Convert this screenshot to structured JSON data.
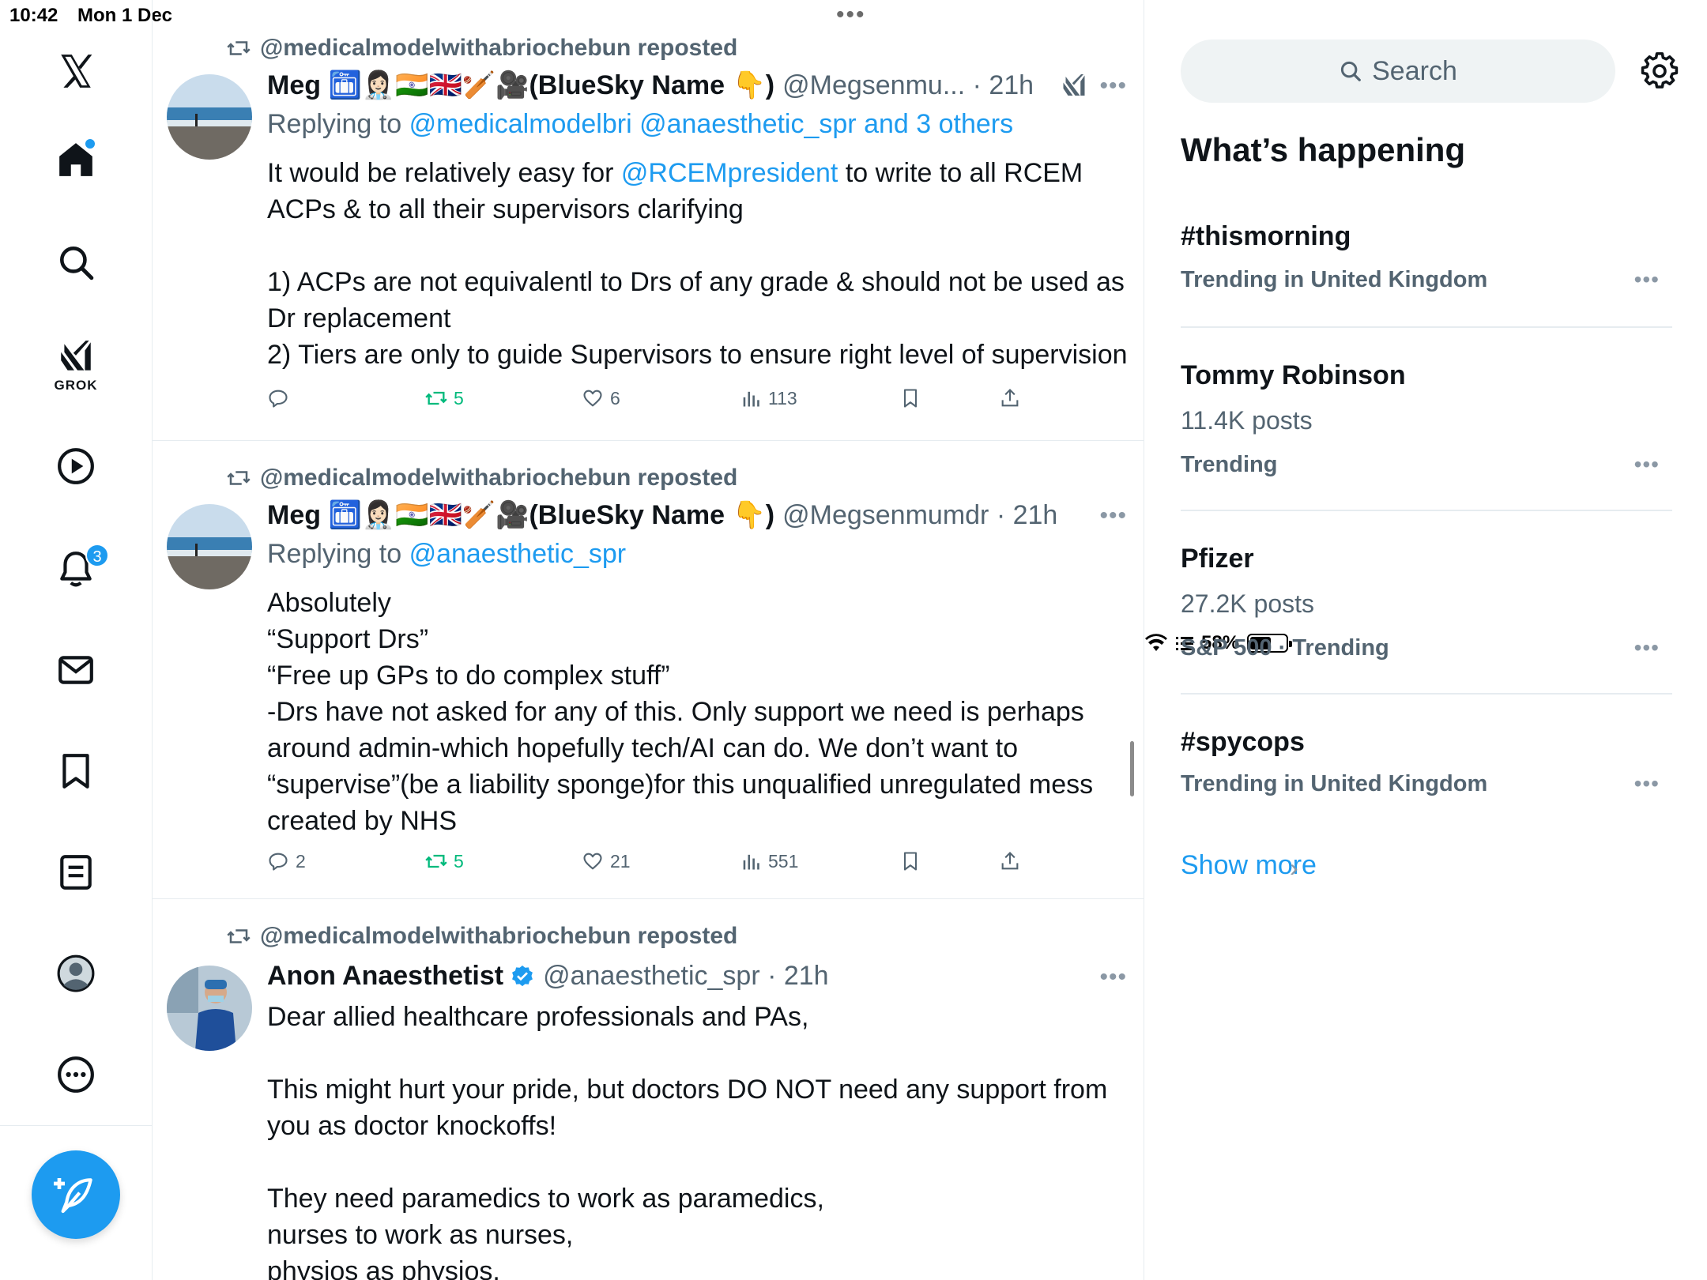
{
  "status_bar": {
    "time": "10:42",
    "date": "Mon 1 Dec",
    "battery": "58%",
    "battery_level": 0.58
  },
  "nav": {
    "grok_label": "GROK",
    "notifications_count": "3"
  },
  "feed": {
    "tweets": [
      {
        "repost_label": "@medicalmodelwithabriochebun reposted",
        "name": "Meg 🛅👩🏻‍⚕️🇮🇳🇬🇧🏏🎥(BlueSky Name 👇)",
        "handle": "@Megsenmu... · 21h",
        "replying_prefix": "Replying to",
        "replying_to": "@medicalmodelbri @anaesthetic_spr and 3 others",
        "body_pre": "It would be relatively easy for ",
        "body_mention": "@RCEMpresident",
        "body_post": " to write to all RCEM ACPs & to all their supervisors clarifying\n\n1) ACPs are not equivalentl to Drs of any grade & should not be used as Dr replacement\n2) Tiers are only to guide Supervisors to ensure right level of supervision",
        "replies": "",
        "reposts": "5",
        "likes": "6",
        "views": "113"
      },
      {
        "repost_label": "@medicalmodelwithabriochebun reposted",
        "name": "Meg 🛅👩🏻‍⚕️🇮🇳🇬🇧🏏🎥(BlueSky Name 👇)",
        "handle": "@Megsenmumdr · 21h",
        "replying_prefix": "Replying to",
        "replying_to": "@anaesthetic_spr",
        "body": "Absolutely\n“Support Drs”\n“Free up GPs to do complex stuff”\n-Drs have not asked for any of this. Only support we need is perhaps around admin-which hopefully tech/AI can do. We don’t want to “supervise”(be a liability sponge)for this unqualified unregulated mess created by NHS",
        "replies": "2",
        "reposts": "5",
        "likes": "21",
        "views": "551"
      },
      {
        "repost_label": "@medicalmodelwithabriochebun reposted",
        "name": "Anon Anaesthetist",
        "handle": "@anaesthetic_spr · 21h",
        "body": "Dear allied healthcare professionals and PAs,\n\nThis might hurt your pride, but doctors DO NOT need any support from you as doctor knockoffs!\n\nThey need paramedics to work as paramedics,\nnurses to work as nurses,\nphysios as physios."
      }
    ]
  },
  "sidebar": {
    "search_placeholder": "Search",
    "title": "What’s happening",
    "trends": [
      {
        "name": "#thismorning",
        "posts": "",
        "context": "Trending in United Kingdom"
      },
      {
        "name": "Tommy Robinson",
        "posts": "11.4K posts",
        "context": "Trending"
      },
      {
        "name": "Pfizer",
        "posts": "27.2K posts",
        "context": "S&P 500 · Trending"
      },
      {
        "name": "#spycops",
        "posts": "",
        "context": "Trending in United Kingdom"
      }
    ],
    "show_more": "Show more"
  },
  "colors": {
    "accent": "#1d9bf0",
    "muted": "#536471",
    "repost_green": "#00ba7c"
  }
}
